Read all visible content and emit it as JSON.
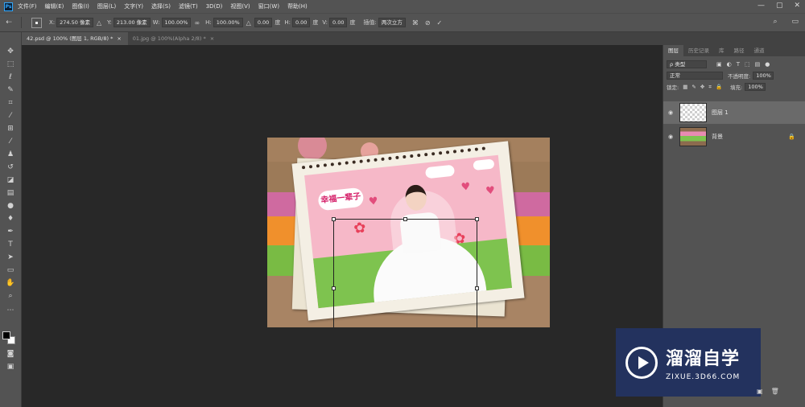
{
  "app": {
    "logo": "Ps"
  },
  "menu": [
    "文件(F)",
    "编辑(E)",
    "图像(I)",
    "图层(L)",
    "文字(Y)",
    "选择(S)",
    "滤镜(T)",
    "3D(D)",
    "视图(V)",
    "窗口(W)",
    "帮助(H)"
  ],
  "window_controls": [
    "—",
    "▢",
    "✕"
  ],
  "options": {
    "x_label": "X:",
    "x_value": "274.50 像素",
    "y_label": "Y:",
    "y_value": "213.00 像素",
    "w_label": "W:",
    "w_value": "100.00%",
    "h_label": "H:",
    "h_value": "100.00%",
    "angle_value": "0.00",
    "angle_unit": "度",
    "hskew_label": "H:",
    "hskew_value": "0.00",
    "hskew_unit": "度",
    "vskew_label": "V:",
    "vskew_value": "0.00",
    "vskew_unit": "度",
    "interp_label": "插值:",
    "interp_value": "两次立方"
  },
  "tabs": [
    {
      "label": "42.psd @ 100% (图层 1, RGB/8) *",
      "close": "×"
    },
    {
      "label": "01.jpg @ 100%(Alpha 2/8) *",
      "close": "×"
    }
  ],
  "artwork": {
    "banner_text": "幸福一辈子"
  },
  "panel": {
    "tabs": [
      "图层",
      "历史记录",
      "库",
      "路径",
      "通道"
    ],
    "filter_kind": "ρ 类型",
    "blend_mode": "正常",
    "opacity_label": "不透明度:",
    "opacity_value": "100%",
    "lock_label": "锁定:",
    "fill_label": "填充:",
    "fill_value": "100%",
    "layers": [
      {
        "name": "图层 1",
        "selected": true,
        "locked": false
      },
      {
        "name": "背景",
        "selected": false,
        "locked": true
      }
    ]
  },
  "watermark": {
    "name": "溜溜自学",
    "url": "ZIXUE.3D66.COM"
  }
}
